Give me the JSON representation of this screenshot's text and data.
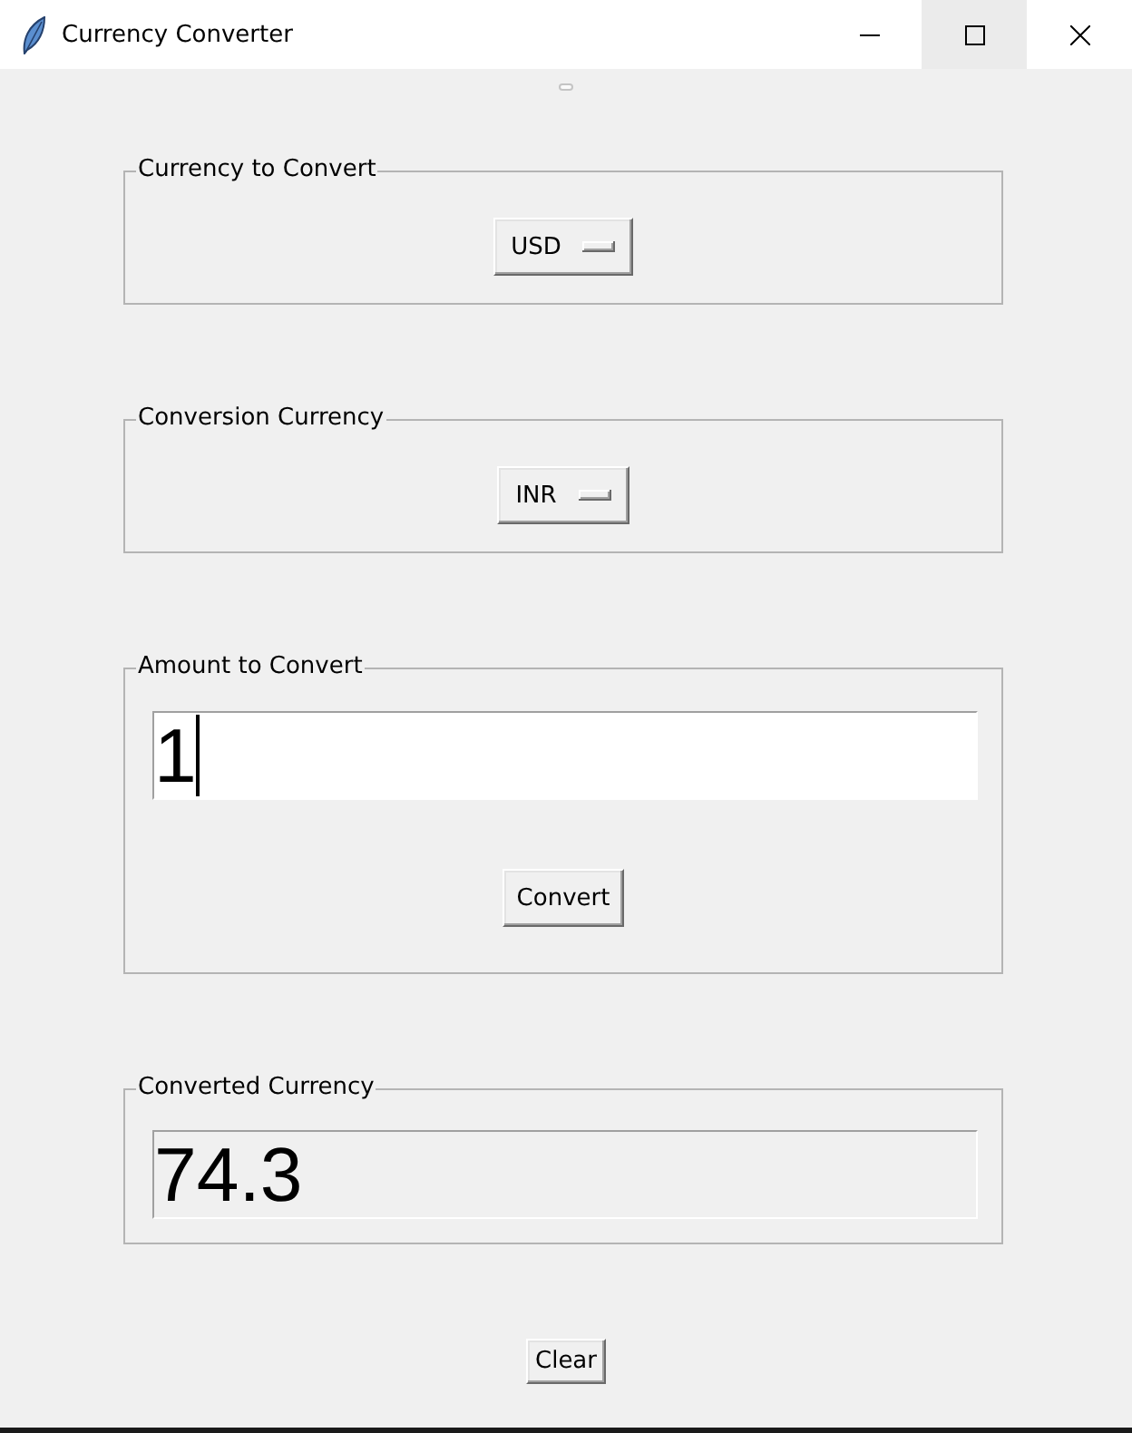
{
  "window": {
    "title": "Currency Converter",
    "controls": [
      {
        "kind": "minimize",
        "hovered": false
      },
      {
        "kind": "maximize",
        "hovered": true
      },
      {
        "kind": "close",
        "hovered": false
      }
    ]
  },
  "groups": [
    {
      "kind": "dropdown",
      "label": "Currency to Convert",
      "value": "USD"
    },
    {
      "kind": "dropdown",
      "label": "Conversion Currency",
      "value": "INR"
    },
    {
      "kind": "entry",
      "label": "Amount to Convert",
      "value": "1",
      "focused": true,
      "button": "Convert"
    },
    {
      "kind": "output",
      "label": "Converted Currency",
      "value": "74.3"
    }
  ],
  "buttons": [
    "Clear"
  ]
}
